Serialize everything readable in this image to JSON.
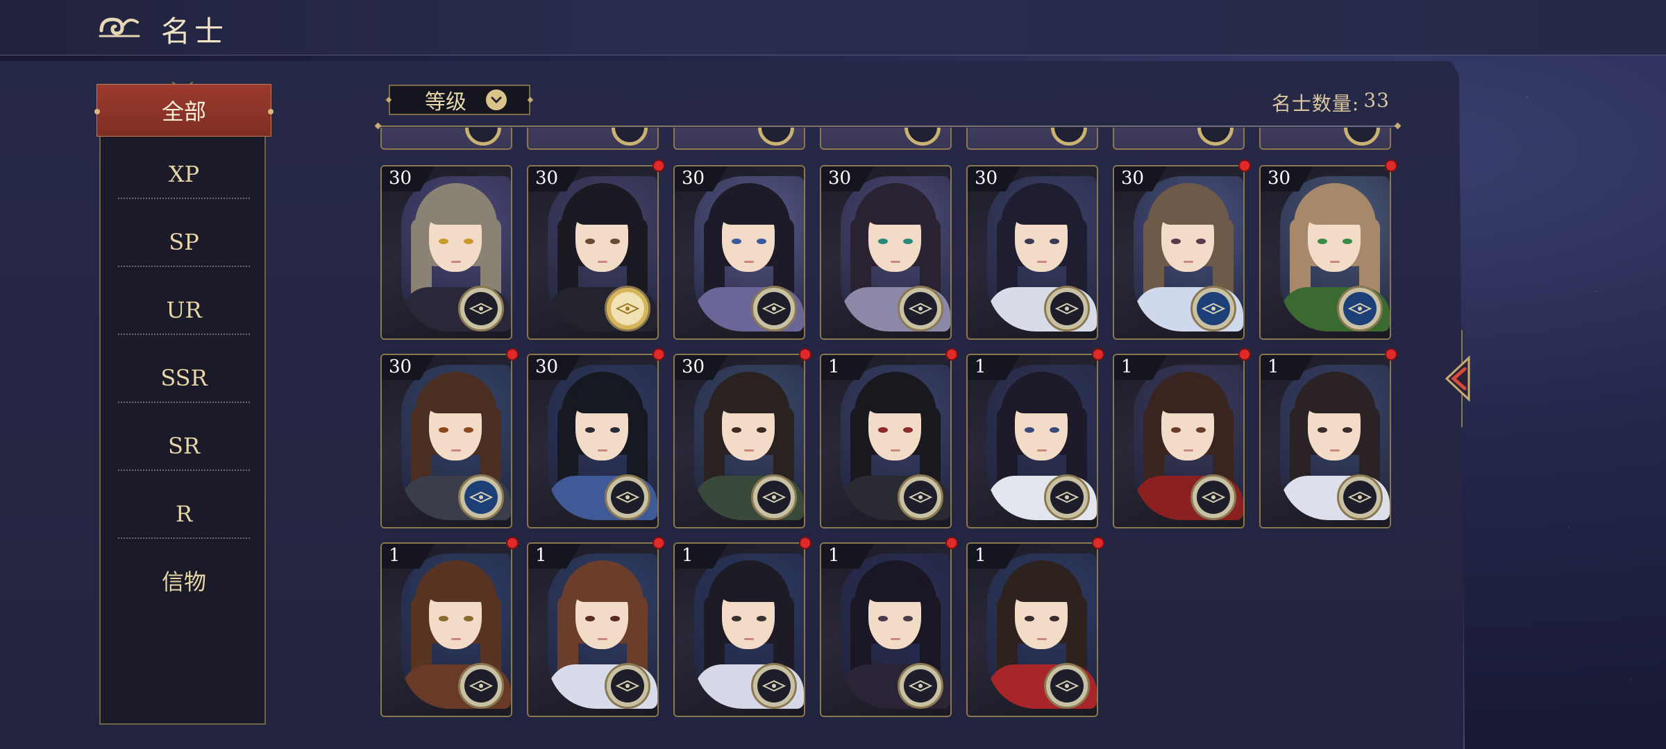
{
  "header": {
    "title": "名士"
  },
  "sidebar": {
    "items": [
      {
        "label": "全部",
        "active": true
      },
      {
        "label": "XP"
      },
      {
        "label": "SP"
      },
      {
        "label": "UR"
      },
      {
        "label": "SSR"
      },
      {
        "label": "SR"
      },
      {
        "label": "R"
      },
      {
        "label": "信物"
      }
    ]
  },
  "toolbar": {
    "sort_label": "等级",
    "count_label": "名士数量:",
    "count_value": "33"
  },
  "colors": {
    "accent_red": "#9c3b2e",
    "gold": "#c9ac72",
    "notify_red": "#e02a2a"
  },
  "cards": [
    {
      "level": "30",
      "badge": "dark",
      "dot": false,
      "hair": "#8a8275",
      "outfit": "#2a2838",
      "eye": "#c99a2a",
      "bg": "#4d4a7a"
    },
    {
      "level": "30",
      "badge": "gold",
      "dot": true,
      "hair": "#1b1a22",
      "outfit": "#23232e",
      "eye": "#6a4a30",
      "bg": "#45436a"
    },
    {
      "level": "30",
      "badge": "dark",
      "dot": false,
      "hair": "#1e1b28",
      "outfit": "#6a6698",
      "eye": "#3a5aa0",
      "bg": "#5a5a8a"
    },
    {
      "level": "30",
      "badge": "dark",
      "dot": false,
      "hair": "#2a2230",
      "outfit": "#8c88a8",
      "eye": "#2a8a7a",
      "bg": "#4e4c78"
    },
    {
      "level": "30",
      "badge": "dark",
      "dot": false,
      "hair": "#1e1e30",
      "outfit": "#d8dbe8",
      "eye": "#3a3a55",
      "bg": "#3c4268"
    },
    {
      "level": "30",
      "badge": "blue",
      "dot": true,
      "hair": "#6e5a48",
      "outfit": "#cfd8ec",
      "eye": "#5a3a4a",
      "bg": "#4a5480"
    },
    {
      "level": "30",
      "badge": "blue",
      "dot": true,
      "hair": "#a8886a",
      "outfit": "#3a6a30",
      "eye": "#3a8a4a",
      "bg": "#4a5a7a"
    },
    {
      "level": "30",
      "badge": "blue",
      "dot": true,
      "hair": "#4a2e22",
      "outfit": "#3a3e4a",
      "eye": "#8a4a20",
      "bg": "#35466a"
    },
    {
      "level": "30",
      "badge": "dark",
      "dot": true,
      "hair": "#161822",
      "outfit": "#405a98",
      "eye": "#2a2a35",
      "bg": "#2e3a60"
    },
    {
      "level": "30",
      "badge": "dark",
      "dot": true,
      "hair": "#2a2220",
      "outfit": "#3a4a3a",
      "eye": "#3a2a20",
      "bg": "#3a4a6a"
    },
    {
      "level": "1",
      "badge": "dark",
      "dot": true,
      "hair": "#18181e",
      "outfit": "#2a2a32",
      "eye": "#8a2a2a",
      "bg": "#3a4268"
    },
    {
      "level": "1",
      "badge": "dark",
      "dot": true,
      "hair": "#1e1a2a",
      "outfit": "#e4e6ee",
      "eye": "#3a4a7a",
      "bg": "#2e3658"
    },
    {
      "level": "1",
      "badge": "dark",
      "dot": true,
      "hair": "#3a2420",
      "outfit": "#8a2020",
      "eye": "#6a3a2a",
      "bg": "#3a3a5a"
    },
    {
      "level": "1",
      "badge": "dark",
      "dot": true,
      "hair": "#2a2224",
      "outfit": "#dde0ea",
      "eye": "#3a2a2a",
      "bg": "#3a4468"
    },
    {
      "level": "1",
      "badge": "dark",
      "dot": true,
      "hair": "#5a3422",
      "outfit": "#6a3a28",
      "eye": "#8a6a30",
      "bg": "#2e3e66"
    },
    {
      "level": "1",
      "badge": "dark",
      "dot": true,
      "hair": "#6a3e2a",
      "outfit": "#d8dcea",
      "eye": "#5a2a20",
      "bg": "#304068"
    },
    {
      "level": "1",
      "badge": "dark",
      "dot": true,
      "hair": "#1e1a26",
      "outfit": "#d6d8e8",
      "eye": "#3a3030",
      "bg": "#2c3a62"
    },
    {
      "level": "1",
      "badge": "dark",
      "dot": true,
      "hair": "#1a1624",
      "outfit": "#2a2436",
      "eye": "#4a3a4a",
      "bg": "#2a2e52"
    },
    {
      "level": "1",
      "badge": "dark",
      "dot": true,
      "hair": "#2e221e",
      "outfit": "#a8262a",
      "eye": "#3a2a2a",
      "bg": "#2e3c64"
    }
  ]
}
